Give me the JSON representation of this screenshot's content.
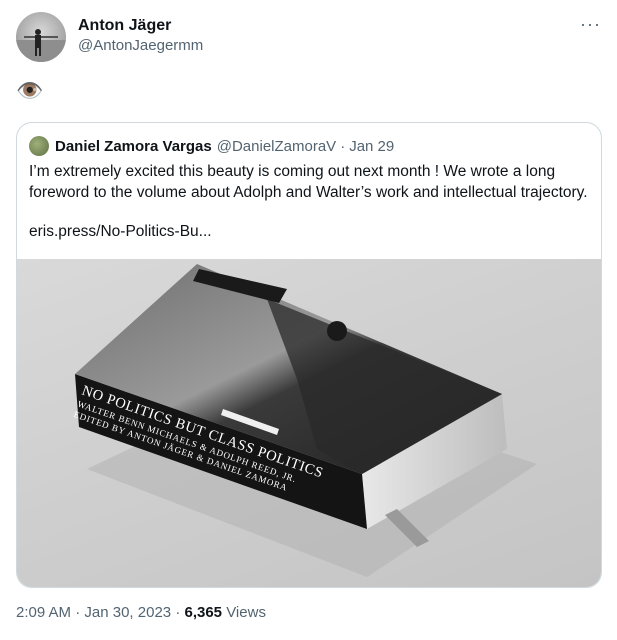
{
  "author": {
    "display_name": "Anton Jäger",
    "handle": "@AntonJaegermm"
  },
  "menu_icon": "more-horizontal-icon",
  "tweet_text": "👁️",
  "quoted_tweet": {
    "display_name": "Daniel Zamora Vargas",
    "handle": "@DanielZamoraV",
    "separator": "·",
    "date": "Jan 29",
    "text": "I’m extremely excited this beauty is coming out next month ! We wrote a long foreword to the volume about Adolph and Walter’s work and intellectual trajectory.",
    "link": "eris.press/No-Politics-Bu...",
    "book": {
      "spine_title": "NO POLITICS BUT CLASS POLITICS",
      "spine_line2": "WALTER BENN MICHAELS & ADOLPH REED, JR.",
      "spine_line3": "EDITED BY ANTON JÄGER & DANIEL ZAMORA"
    }
  },
  "footer": {
    "time": "2:09 AM",
    "sep1": "·",
    "date": "Jan 30, 2023",
    "sep2": "·",
    "views_count": "6,365",
    "views_label": "Views"
  }
}
